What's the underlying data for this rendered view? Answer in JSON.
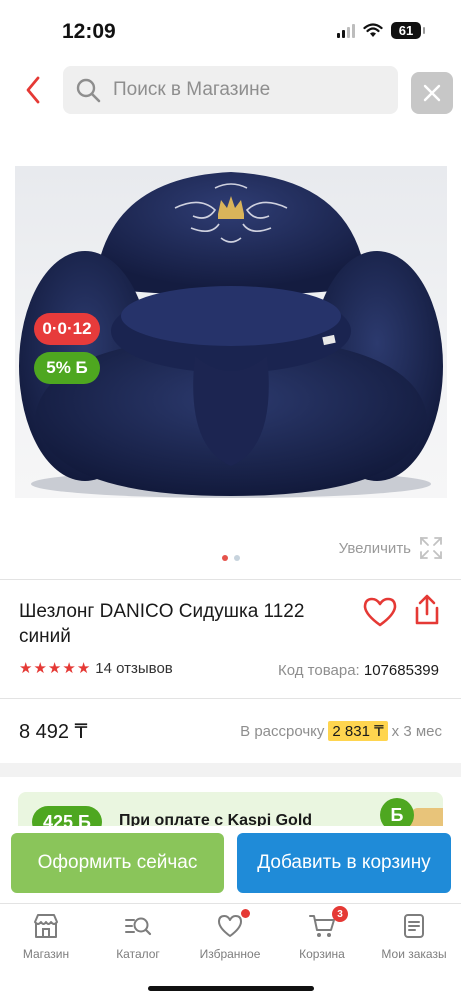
{
  "status_bar": {
    "time": "12:09",
    "battery": "61"
  },
  "search": {
    "placeholder": "Поиск в Магазине"
  },
  "product": {
    "badges": {
      "installment": "0·0·12",
      "bonus": "5% Б"
    },
    "zoom_label": "Увеличить",
    "title": "Шезлонг DANICO Сидушка 1122 синий",
    "rating": 5,
    "reviews": "14 отзывов",
    "code_label": "Код товара:",
    "code_value": "107685399",
    "price": "8 492 ₸",
    "installment": {
      "prefix": "В рассрочку",
      "amount": "2 831 ₸",
      "suffix": "х 3 мес"
    }
  },
  "kaspi_banner": {
    "bonus": "425 Б",
    "text": "При оплате с Kaspi Gold"
  },
  "actions": {
    "order_now": "Оформить сейчас",
    "add_to_cart": "Добавить в корзину"
  },
  "tabs": [
    {
      "label": "Магазин",
      "icon": "store-icon"
    },
    {
      "label": "Каталог",
      "icon": "catalog-search-icon"
    },
    {
      "label": "Избранное",
      "icon": "heart-icon"
    },
    {
      "label": "Корзина",
      "icon": "cart-icon",
      "badge": "3"
    },
    {
      "label": "Мои заказы",
      "icon": "orders-icon"
    }
  ],
  "colors": {
    "accent_red": "#e53935",
    "green": "#4ea720",
    "blue": "#1f8bd8",
    "light_green": "#8ac55a"
  }
}
